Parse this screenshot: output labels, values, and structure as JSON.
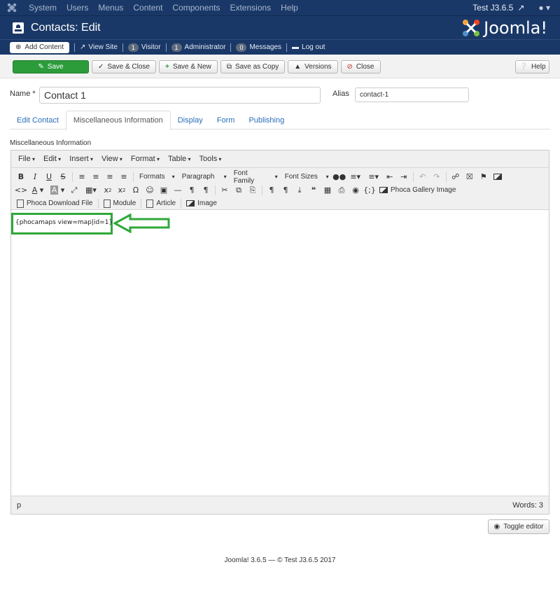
{
  "topnav": {
    "menu": [
      "System",
      "Users",
      "Menus",
      "Content",
      "Components",
      "Extensions",
      "Help"
    ],
    "site_name": "Test J3.6.5"
  },
  "header": {
    "title": "Contacts: Edit",
    "brand": "Joomla!"
  },
  "statusbar": {
    "add_content": "Add Content",
    "view_site": "View Site",
    "visitor_count": "1",
    "visitor_label": "Visitor",
    "admin_count": "1",
    "admin_label": "Administrator",
    "messages_count": "0",
    "messages_label": "Messages",
    "logout": "Log out"
  },
  "toolbar": {
    "save": "Save",
    "save_close": "Save & Close",
    "save_new": "Save & New",
    "save_copy": "Save as Copy",
    "versions": "Versions",
    "close": "Close",
    "help": "Help"
  },
  "form": {
    "name_label": "Name *",
    "name_value": "Contact 1",
    "alias_label": "Alias",
    "alias_value": "contact-1"
  },
  "tabs": [
    "Edit Contact",
    "Miscellaneous Information",
    "Display",
    "Form",
    "Publishing"
  ],
  "section_label": "Miscellaneous Information",
  "editor": {
    "menus": [
      "File",
      "Edit",
      "Insert",
      "View",
      "Format",
      "Table",
      "Tools"
    ],
    "dropdowns": {
      "formats": "Formats",
      "paragraph": "Paragraph",
      "font_family": "Font Family",
      "font_sizes": "Font Sizes"
    },
    "buttons": {
      "phoca_gallery": "Phoca Gallery Image",
      "phoca_download": "Phoca Download File",
      "module": "Module",
      "article": "Article",
      "image": "Image"
    },
    "content": "{phocamaps view=map|id=1}",
    "path": "p",
    "words": "Words: 3",
    "highlight_color": "#2fa83a"
  },
  "toggle_editor": "Toggle editor",
  "footer": "Joomla! 3.6.5 — © Test J3.6.5 2017"
}
